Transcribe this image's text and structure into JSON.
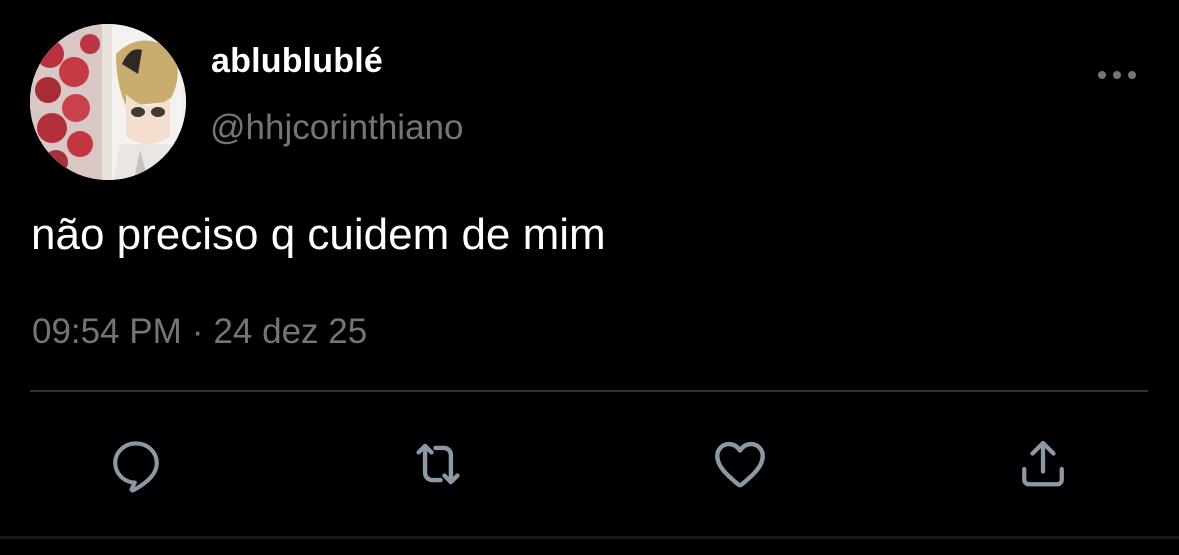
{
  "user": {
    "display_name": "ablublublé",
    "handle": "@hhjcorinthiano",
    "avatar_icon": "profile-avatar"
  },
  "tweet": {
    "text": "não preciso q cuidem de mim",
    "time": "09:54 PM",
    "separator": "·",
    "date": "24 dez 25"
  },
  "actions": {
    "more_icon": "more-horizontal-icon",
    "reply_icon": "reply-icon",
    "retweet_icon": "retweet-icon",
    "like_icon": "heart-icon",
    "share_icon": "share-icon"
  },
  "colors": {
    "background": "#000000",
    "primary_text": "#ffffff",
    "secondary_text": "#71767b",
    "divider": "#2f3336"
  }
}
